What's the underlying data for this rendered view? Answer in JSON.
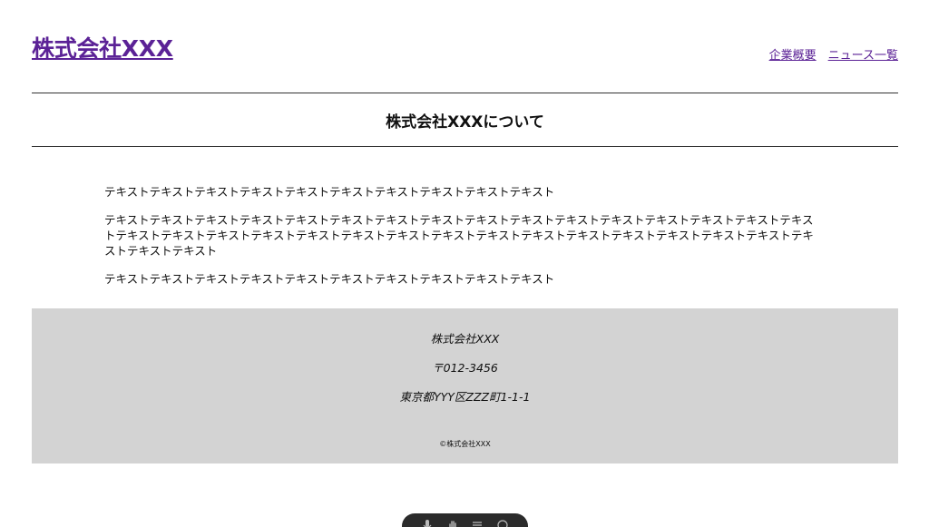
{
  "header": {
    "site_title": "株式会社XXX",
    "nav": [
      {
        "label": "企業概要"
      },
      {
        "label": "ニュース一覧"
      }
    ]
  },
  "main": {
    "title": "株式会社XXXについて",
    "paragraphs": [
      "テキストテキストテキストテキストテキストテキストテキストテキストテキストテキスト",
      "テキストテキストテキストテキストテキストテキストテキストテキストテキストテキストテキストテキストテキストテキストテキストテキストテキストテキストテキストテキストテキストテキストテキストテキストテキストテキストテキストテキストテキストテキストテキストテキストテキストテキスト",
      "テキストテキストテキストテキストテキストテキストテキストテキストテキストテキスト"
    ]
  },
  "footer": {
    "company": "株式会社XXX",
    "postal": "〒012-3456",
    "address": "東京都YYY区ZZZ町1-1-1",
    "copyright": "©株式会社XXX"
  },
  "toolbar": {
    "icons": [
      "microphone-icon",
      "hand-icon",
      "menu-icon",
      "more-icon"
    ]
  },
  "colors": {
    "link": "#5b2296",
    "footer_bg": "#d3d3d3",
    "toolbar_bg": "#2b2b2b"
  }
}
